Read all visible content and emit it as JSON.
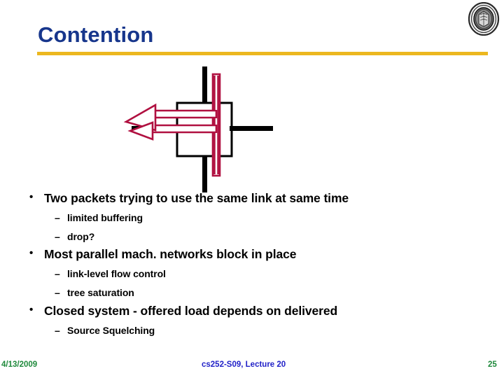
{
  "slide": {
    "title": "Contention",
    "title_color": "#17368c",
    "rule_color": "#ecb71f",
    "background": "#ffffff"
  },
  "logo": {
    "name": "uc-berkeley-seal",
    "alt": "University seal"
  },
  "diagram": {
    "name": "switch-contention-diagram",
    "description": "Network switch with two packets contending for the same outgoing link",
    "colors": {
      "wire": "#000000",
      "packet": "#b01040",
      "packet_fill": "#ffffff"
    },
    "elements": [
      {
        "name": "switch-box",
        "type": "rect",
        "stroke": "#000000"
      },
      {
        "name": "vertical-link-top",
        "type": "line",
        "stroke": "#000000"
      },
      {
        "name": "vertical-link-bottom",
        "type": "line",
        "stroke": "#000000"
      },
      {
        "name": "horizontal-link-left",
        "type": "line",
        "stroke": "#000000"
      },
      {
        "name": "horizontal-link-right",
        "type": "line",
        "stroke": "#000000"
      },
      {
        "name": "packet-path-vertical",
        "type": "path",
        "stroke": "#b01040"
      },
      {
        "name": "packet-arrow-upper",
        "type": "arrow",
        "stroke": "#b01040"
      },
      {
        "name": "packet-arrow-lower",
        "type": "arrow",
        "stroke": "#b01040"
      }
    ]
  },
  "content": {
    "groups": [
      {
        "heading": "Two packets trying to use the same link at same time",
        "sub": [
          "limited buffering",
          "drop?"
        ]
      },
      {
        "heading": "Most parallel mach. networks block in place",
        "sub": [
          "link-level flow control",
          "tree saturation"
        ]
      },
      {
        "heading": "Closed system - offered load depends on delivered",
        "sub": [
          "Source Squelching"
        ]
      }
    ],
    "bullet_glyph": "•",
    "subbullet_glyph": "–"
  },
  "footer": {
    "date": "4/13/2009",
    "center": "cs252-S09, Lecture 20",
    "page": "25",
    "date_color": "#1f8a3c",
    "center_color": "#2222c8",
    "page_color": "#1f8a3c"
  }
}
